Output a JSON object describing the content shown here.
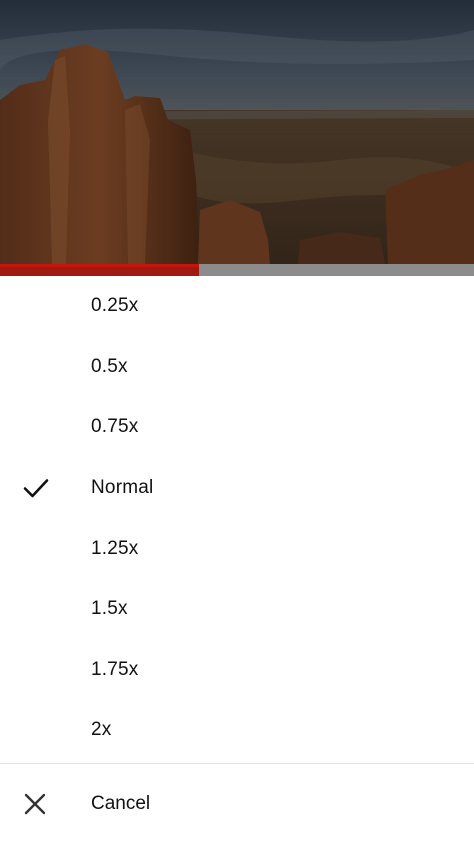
{
  "player": {
    "progress_fraction": 0.42,
    "accent_color": "#c4160d"
  },
  "speed_menu": {
    "options": [
      {
        "label": "0.25x",
        "selected": false
      },
      {
        "label": "0.5x",
        "selected": false
      },
      {
        "label": "0.75x",
        "selected": false
      },
      {
        "label": "Normal",
        "selected": true
      },
      {
        "label": "1.25x",
        "selected": false
      },
      {
        "label": "1.5x",
        "selected": false
      },
      {
        "label": "1.75x",
        "selected": false
      },
      {
        "label": "2x",
        "selected": false
      }
    ],
    "selected_icon": "checkmark-icon",
    "cancel_label": "Cancel",
    "cancel_icon": "close-icon"
  }
}
